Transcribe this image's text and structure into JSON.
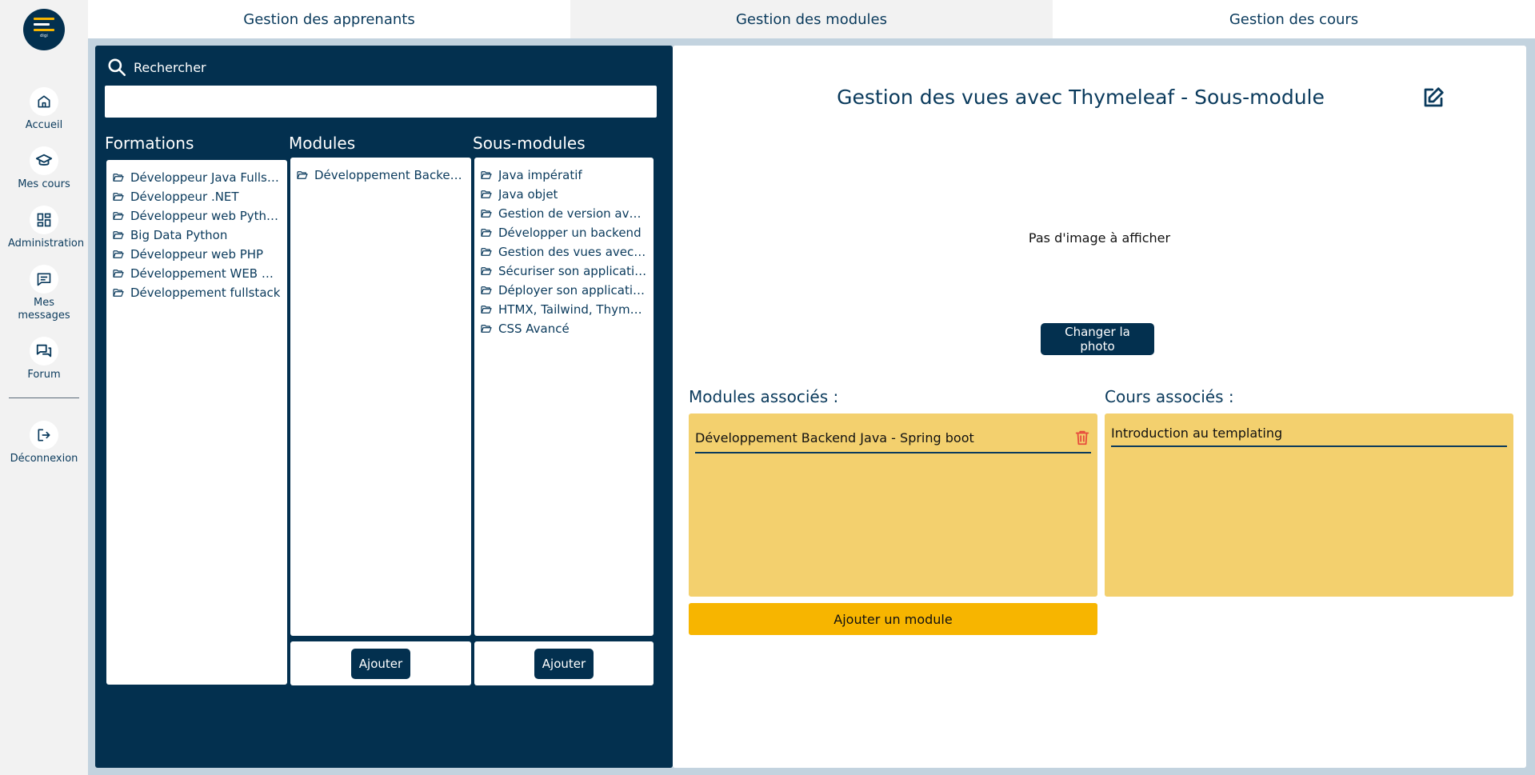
{
  "logo": {
    "brand_text": "digi"
  },
  "sidebar": {
    "items": [
      {
        "label": "Accueil",
        "icon": "home-icon"
      },
      {
        "label": "Mes cours",
        "icon": "graduation-cap-icon"
      },
      {
        "label": "Administration",
        "icon": "dashboard-icon"
      },
      {
        "label": "Mes messages",
        "icon": "message-icon"
      },
      {
        "label": "Forum",
        "icon": "forum-icon"
      }
    ],
    "logout": {
      "label": "Déconnexion",
      "icon": "logout-icon"
    }
  },
  "tabs": [
    {
      "label": "Gestion des apprenants"
    },
    {
      "label": "Gestion des modules"
    },
    {
      "label": "Gestion des cours"
    }
  ],
  "search": {
    "label": "Rechercher",
    "value": ""
  },
  "columns": {
    "formations": {
      "title": "Formations",
      "items": [
        "Développeur Java Fullstack",
        "Développeur .NET",
        "Développeur web Python",
        "Big Data Python",
        "Développeur web PHP",
        "Développement WEB React",
        "Développement fullstack"
      ]
    },
    "modules": {
      "title": "Modules",
      "items": [
        "Développement Backend Java - Spring boot"
      ],
      "add_label": "Ajouter"
    },
    "sous_modules": {
      "title": "Sous-modules",
      "items": [
        "Java impératif",
        "Java objet",
        "Gestion de version avec Git",
        "Développer un backend",
        "Gestion des vues avec Thymeleaf",
        "Sécuriser son application",
        "Déployer son application",
        "HTMX, Tailwind, Thymeleaf",
        "CSS Avancé"
      ],
      "add_label": "Ajouter"
    }
  },
  "detail": {
    "title": "Gestion des vues avec Thymeleaf - Sous-module",
    "no_image": "Pas d'image à afficher",
    "change_photo": "Changer la photo",
    "modules_title": "Modules associés :",
    "modules": [
      "Développement Backend Java - Spring boot"
    ],
    "add_module": "Ajouter un module",
    "courses_title": "Cours associés :",
    "courses": [
      "Introduction au templating"
    ]
  },
  "colors": {
    "navy": "#03304f",
    "accent_yellow": "#f7b500",
    "panel_yellow": "#f3d06e",
    "delete_red": "#e74c3c",
    "background_blue": "#c3d3df"
  }
}
